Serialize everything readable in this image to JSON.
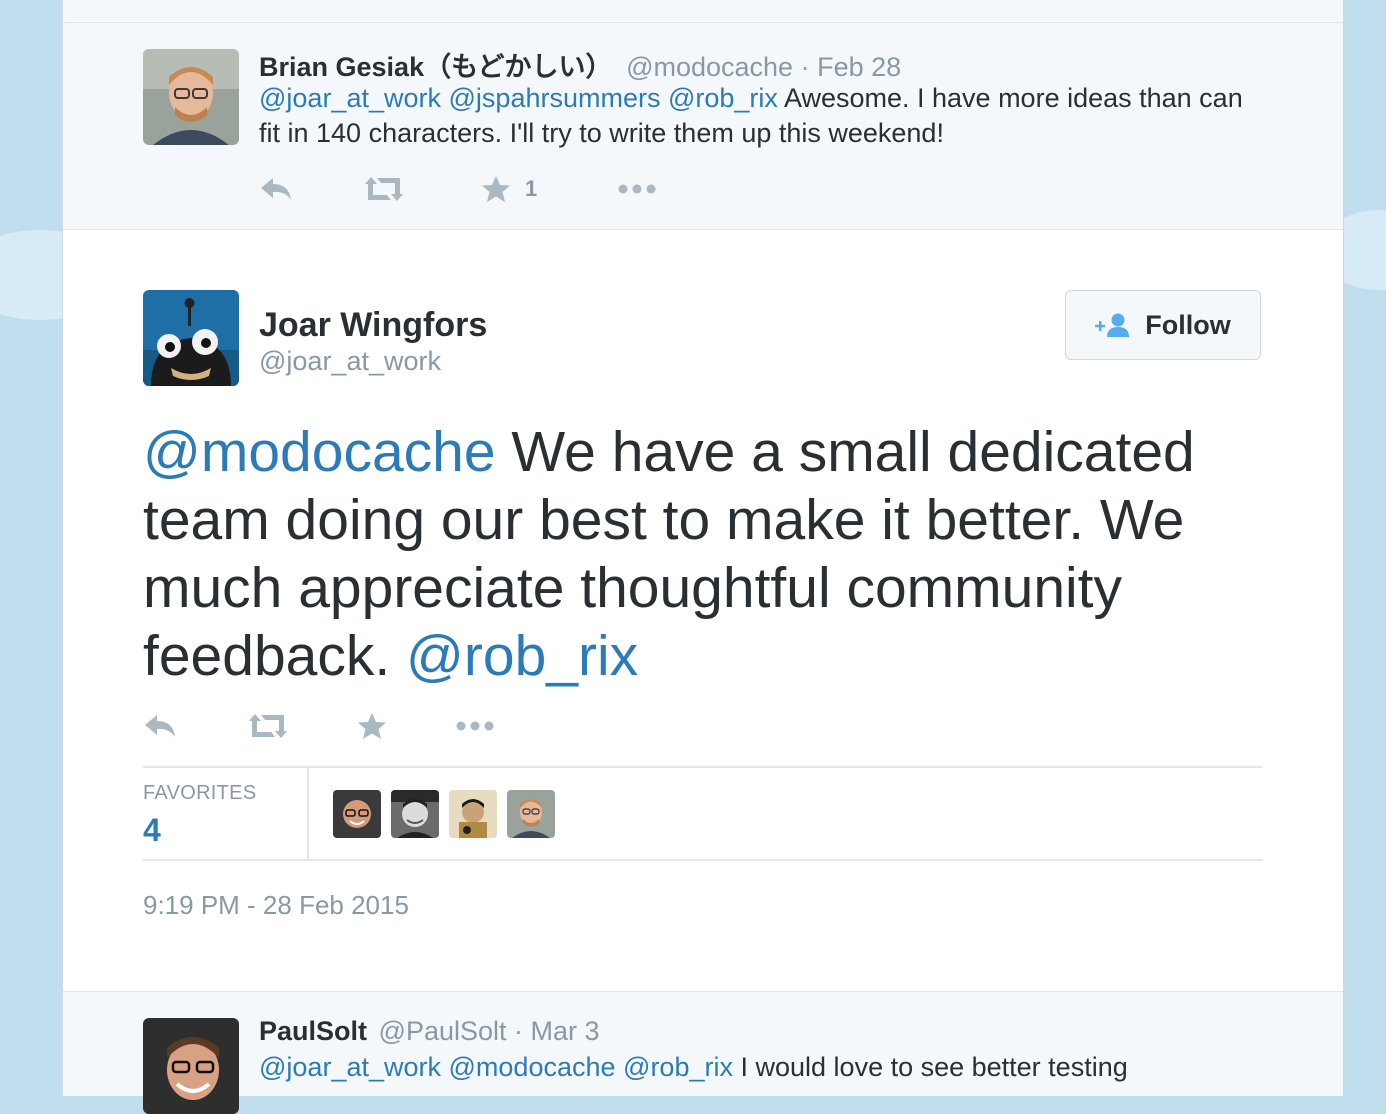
{
  "colors": {
    "background": "#c0deed",
    "link": "#2b7bb9",
    "text": "#292f33",
    "muted": "#8899a6",
    "icon": "#aab8c2"
  },
  "reply_top": {
    "name": "Brian Gesiak（もどかしい）",
    "handle": "@modocache",
    "date": "· Feb 28",
    "mention_1": "@joar_at_work",
    "mention_2": "@jspahrsummers",
    "mention_3": "@rob_rix",
    "text": "Awesome. I have more ideas than can fit in 140 characters. I'll try to write them up this weekend!",
    "favorite_count": "1",
    "icons": [
      "reply-icon",
      "retweet-icon",
      "favorite-icon",
      "more-icon"
    ]
  },
  "main_tweet": {
    "name": "Joar Wingfors",
    "handle": "@joar_at_work",
    "follow_label": "Follow",
    "mention_1": "@modocache",
    "text": "We have a small dedicated team doing our best to make it better. We much appreciate thoughtful community feedback.",
    "mention_2": "@rob_rix",
    "favorites_label": "FAVORITES",
    "favorites_count": "4",
    "timestamp": "9:19 PM - 28 Feb 2015"
  },
  "reply_bottom": {
    "name": "PaulSolt",
    "handle": "@PaulSolt",
    "date": "· Mar 3",
    "mention_1": "@joar_at_work",
    "mention_2": "@modocache",
    "mention_3": "@rob_rix",
    "text": "I would love to see better testing"
  }
}
